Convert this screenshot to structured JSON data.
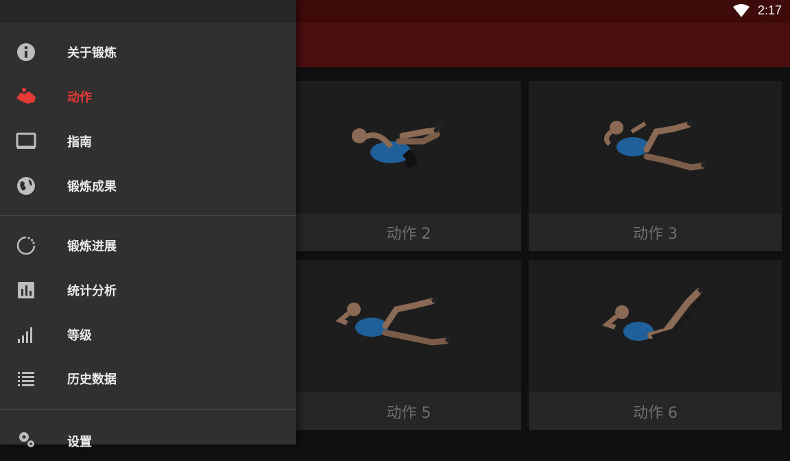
{
  "status_bar": {
    "time": "2:17",
    "wifi_icon": "wifi-icon"
  },
  "drawer": {
    "groups": [
      [
        {
          "label": "关于锻炼",
          "icon": "info-icon"
        },
        {
          "label": "动作",
          "icon": "body-icon",
          "active": true
        },
        {
          "label": "指南",
          "icon": "monitor-icon"
        },
        {
          "label": "锻炼成果",
          "icon": "globe-icon"
        }
      ],
      [
        {
          "label": "锻炼进展",
          "icon": "progress-icon"
        },
        {
          "label": "统计分析",
          "icon": "stats-icon"
        },
        {
          "label": "等级",
          "icon": "signal-bars-icon"
        },
        {
          "label": "历史数据",
          "icon": "list-icon"
        }
      ],
      [
        {
          "label": "设置",
          "icon": "gears-icon"
        }
      ]
    ],
    "active_color": "#e53935"
  },
  "exercises": [
    {
      "label": "动作 2"
    },
    {
      "label": "动作 3"
    },
    {
      "label": "动作 5"
    },
    {
      "label": "动作 6"
    }
  ]
}
